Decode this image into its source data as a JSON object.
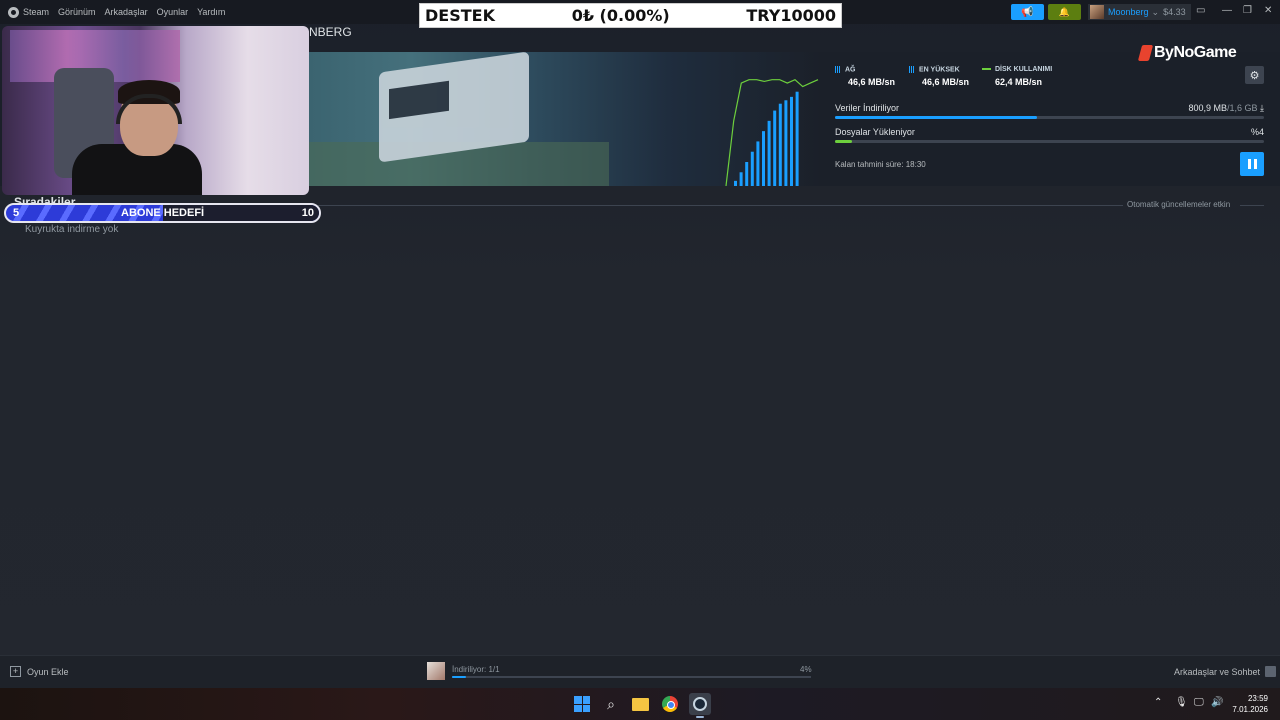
{
  "menu": {
    "items": [
      "Steam",
      "Görünüm",
      "Arkadaşlar",
      "Oyunlar",
      "Yardım"
    ],
    "partial_title": "NBERG"
  },
  "topbar": {
    "username": "Moonberg",
    "balance": "$4.33"
  },
  "donation": {
    "label": "DESTEK",
    "amount": "0₺ (0.00%)",
    "goal": "TRY10000"
  },
  "download_stats": {
    "network": {
      "label": "AĞ",
      "value": "46,6 MB/sn"
    },
    "peak": {
      "label": "EN YÜKSEK",
      "value": "46,6 MB/sn"
    },
    "disk": {
      "label": "DİSK KULLANIMI",
      "value": "62,4 MB/sn"
    },
    "brand": "ByNoGame"
  },
  "progress": {
    "download_label": "Veriler İndiriliyor",
    "download_done": "800,9 MB",
    "download_total": "/1,6 GB",
    "download_fraction": 0.47,
    "install_label": "Dosyalar Yükleniyor",
    "install_pct": "%4",
    "install_fraction": 0.04,
    "eta": "Kalan tahmini süre: 18:30"
  },
  "queue": {
    "heading": "Sıradakiler",
    "auto_update": "Otomatik güncellemeler etkin",
    "empty_text": "Kuyrukta indirme yok"
  },
  "sub_goal": {
    "current": "5",
    "title": "ABONE HEDEFİ",
    "target": "10",
    "fraction": 0.5
  },
  "bottombar": {
    "add_game": "Oyun Ekle",
    "download_status": "İndiriliyor: 1/1",
    "download_pct": "4%",
    "friends_chat": "Arkadaşlar ve Sohbet"
  },
  "graph": {
    "bars": [
      3,
      8,
      14,
      20,
      26,
      32,
      38,
      44,
      48,
      50,
      52,
      55
    ],
    "line": [
      0,
      38,
      60,
      62,
      62,
      61,
      62,
      62,
      60,
      62,
      58,
      60,
      62
    ]
  },
  "clock": {
    "time": "23:59",
    "date": "7.01.2026"
  },
  "colors": {
    "accent": "#1a9fff",
    "disk_line": "#6dcf3d",
    "notify": "#5c7e10"
  }
}
